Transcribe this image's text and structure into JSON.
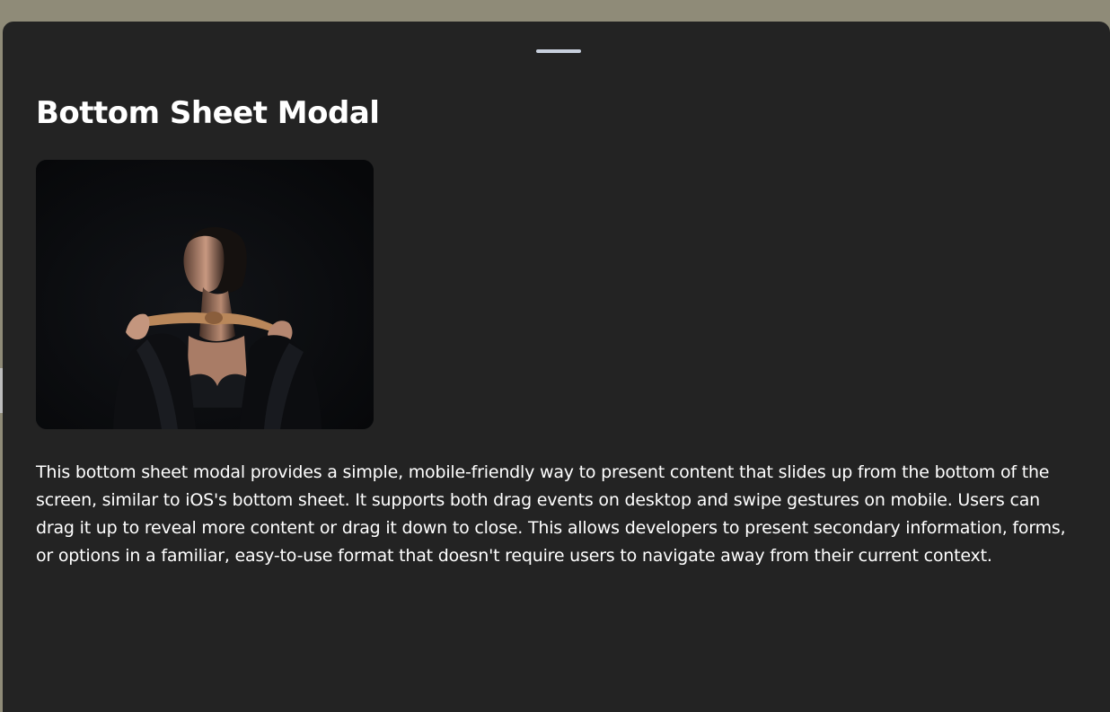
{
  "sheet": {
    "title": "Bottom Sheet Modal",
    "image_alt": "Portrait of a woman in a dark blazer against a black background",
    "description": "This bottom sheet modal provides a simple, mobile-friendly way to present content that slides up from the bottom of the screen, similar to iOS's bottom sheet. It supports both drag events on desktop and swipe gestures on mobile.  Users can drag it up to reveal more content or drag it down to close. This allows developers to present secondary information, forms, or options in a familiar, easy-to-use format that doesn't require users to navigate away from their current context."
  },
  "colors": {
    "backdrop": "#8f8b78",
    "sheet_background": "#232323",
    "handle": "#c7cfdc",
    "text": "#ffffff"
  }
}
